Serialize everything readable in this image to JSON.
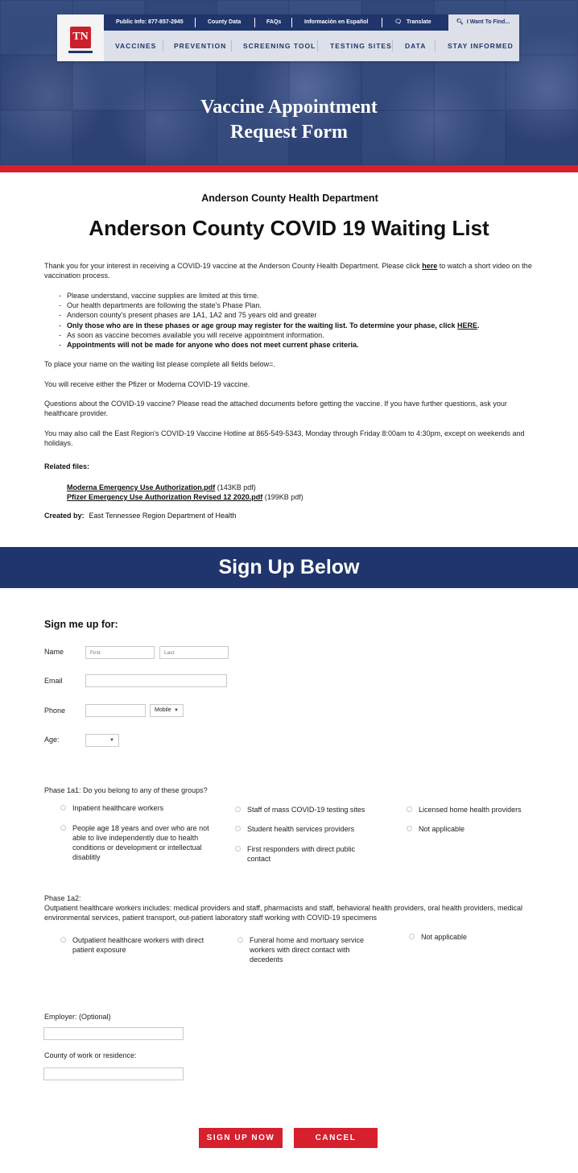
{
  "header": {
    "logo_text": "TN",
    "top_links": [
      "Public Info: 877-857-2945",
      "County Data",
      "FAQs",
      "Información en Español",
      "Translate"
    ],
    "search_label": "I Want To Find...",
    "nav": [
      "VACCINES",
      "PREVENTION",
      "SCREENING TOOL",
      "TESTING SITES",
      "DATA",
      "STAY INFORMED"
    ],
    "hero_title_1": "Vaccine Appointment",
    "hero_title_2": "Request Form"
  },
  "intro": {
    "department": "Anderson County Health Department",
    "title": "Anderson County COVID 19 Waiting List",
    "p1_before": "Thank you for your interest in receiving a COVID-19 vaccine at the Anderson County Health Department.  Please click ",
    "p1_link": "here",
    "p1_after": " to watch a short video on the vaccination process.",
    "bullets": [
      "Please understand, vaccine supplies are limited at this time.",
      "Our health departments are following the state's Phase Plan.",
      "Anderson county's present phases are 1A1, 1A2 and 75 years old and greater"
    ],
    "bullet_bold_1": "Only those who are in these phases or age group may register for the waiting list. To determine your phase, click ",
    "bullet_bold_1_link": "HERE",
    "bullet_bold_1_end": ".",
    "bullet_5": "As soon as vaccine becomes available you will receive appointment information.",
    "bullet_bold_2": "Appointments will not be made for anyone who does not meet current phase criteria.",
    "p2": "To place your name on the waiting list please complete all fields below=.",
    "p3": "You will receive either the Pfizer or Moderna COVID-19 vaccine.",
    "p4": "Questions about the COVID-19 vaccine?  Please read the attached documents before getting the vaccine.  If you have further questions, ask your healthcare provider.",
    "p5": "You may also call the East Region's COVID-19 Vaccine Hotline at 865-549-5343, Monday through Friday 8:00am to 4:30pm, except on weekends and holidays.",
    "related_label": "Related files:",
    "files": [
      {
        "name": "Moderna Emergency Use Authorization.pdf",
        "meta": " (143KB pdf)"
      },
      {
        "name": "Pfizer Emergency Use Authorization Revised 12 2020.pdf",
        "meta": " (199KB pdf)"
      }
    ],
    "created_label": "Created by:",
    "created_value": "East Tennessee Region Department of Health"
  },
  "form": {
    "banner": "Sign Up Below",
    "heading": "Sign me up for:",
    "name_label": "Name",
    "first_placeholder": "First",
    "last_placeholder": "Last",
    "email_label": "Email",
    "phone_label": "Phone",
    "phone_type": "Mobile",
    "age_label": "Age:",
    "phase1a1_question": "Phase 1a1:  Do you belong to any of these groups?",
    "phase1a1_options": [
      "Inpatient healthcare workers",
      "Staff of mass COVID-19 testing sites",
      "Licensed home health providers",
      "People age 18 years and over who are not able to live independently due to health conditions or development or intellectual disablitly",
      "Student health services providers",
      "Not applicable",
      "First responders with direct public contact"
    ],
    "phase1a2_label": "Phase 1a2:",
    "phase1a2_desc": "Outpatient healthcare workers includes: medical providers and staff, pharmacists and staff, behavioral health providers, oral health providers, medical environmental services, patient transport, out-patient laboratory staff working with COVID-19 specimens",
    "phase1a2_options": [
      "Outpatient healthcare workers with direct patient exposure",
      "Funeral home and mortuary service workers with direct contact with decedents",
      "Not applicable"
    ],
    "employer_label": "Employer: (Optional)",
    "county_label": "County of work or residence:",
    "submit_label": "SIGN UP NOW",
    "cancel_label": "CANCEL"
  },
  "colors": {
    "navy": "#1f356b",
    "red": "#d6202e"
  }
}
